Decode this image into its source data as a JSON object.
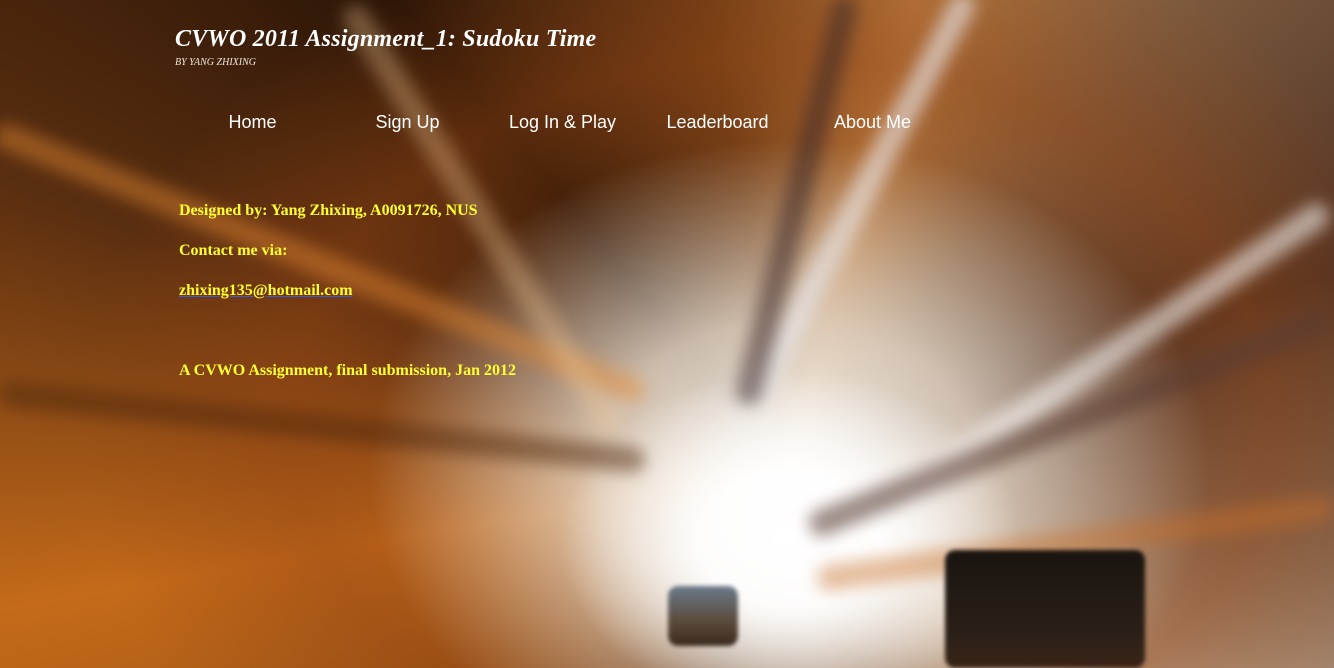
{
  "header": {
    "title": "CVWO 2011 Assignment_1: Sudoku Time",
    "subtitle": "BY YANG ZHIXING"
  },
  "nav": {
    "items": [
      {
        "label": "Home"
      },
      {
        "label": "Sign Up"
      },
      {
        "label": "Log In & Play"
      },
      {
        "label": "Leaderboard"
      },
      {
        "label": "About Me"
      }
    ]
  },
  "content": {
    "designed_by": "Designed by: Yang Zhixing, A0091726, NUS",
    "contact_label": "Contact me via:",
    "email": "zhixing135@hotmail.com",
    "note": "A CVWO Assignment, final submission, Jan 2012"
  },
  "colors": {
    "content_text": "#ffff33",
    "nav_text": "#ffffff",
    "link_underline": "#3b5bd6"
  }
}
